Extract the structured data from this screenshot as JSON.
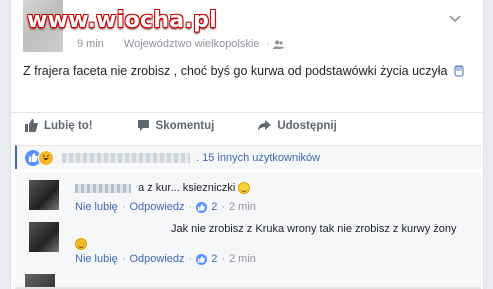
{
  "watermark": "www.wiocha.pl",
  "post": {
    "time": "9 min",
    "location": "Województwo wielkopolskie",
    "text": "Z frajera faceta nie zrobisz , choć byś go kurwa od podstawówki życia uczyła"
  },
  "actions": {
    "like": "Lubię to!",
    "comment": "Skomentuj",
    "share": "Udostępnij"
  },
  "reactions": {
    "others": ". 15 innych użytkowników"
  },
  "comments": [
    {
      "text": "a z kur... ksiezniczki",
      "unlike": "Nie lubię",
      "reply": "Odpowiedz",
      "likes": "2",
      "time": "2 min"
    },
    {
      "text": "Jak nie zrobisz z Kruka wrony tak nie zrobisz z kurwy żony",
      "unlike": "Nie lubię",
      "reply": "Odpowiedz",
      "likes": "2",
      "time": "2 min"
    }
  ],
  "colors": {
    "link": "#4267b2",
    "muted": "#90949c",
    "watermark_outline": "#cc0000"
  }
}
